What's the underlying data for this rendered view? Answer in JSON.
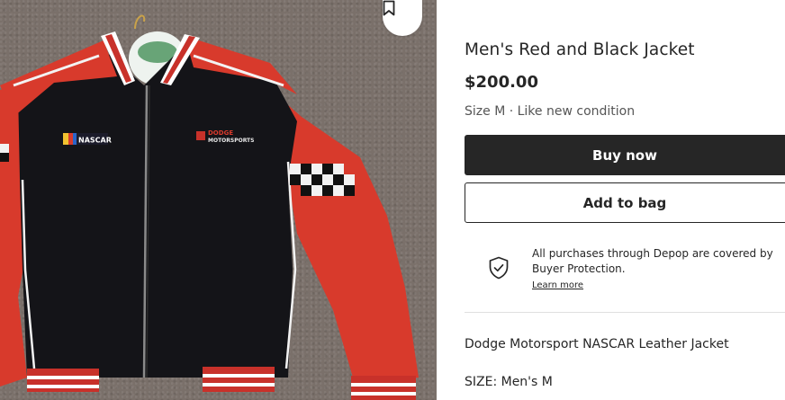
{
  "listing": {
    "title": "Men's Red and Black Jacket",
    "price": "$200.00",
    "meta": "Size M · Like new condition",
    "image_alt": "Dodge Motorsport NASCAR leather jacket on hanger",
    "jacket_logos": {
      "left": "NASCAR",
      "right_top": "DODGE",
      "right_bottom": "MOTORSPORTS"
    }
  },
  "actions": {
    "buy_label": "Buy now",
    "bag_label": "Add to bag"
  },
  "protection": {
    "text": "All purchases through Depop are covered by Buyer Protection.",
    "link_label": "Learn more"
  },
  "description": {
    "line1": "Dodge Motorsport NASCAR Leather Jacket",
    "line2": "SIZE: Men's M"
  },
  "icons": {
    "save": "bookmark-icon",
    "protection": "shield-check-icon"
  },
  "colors": {
    "primary_button": "#262626",
    "jacket_red": "#d83a2c",
    "jacket_black": "#141418"
  }
}
